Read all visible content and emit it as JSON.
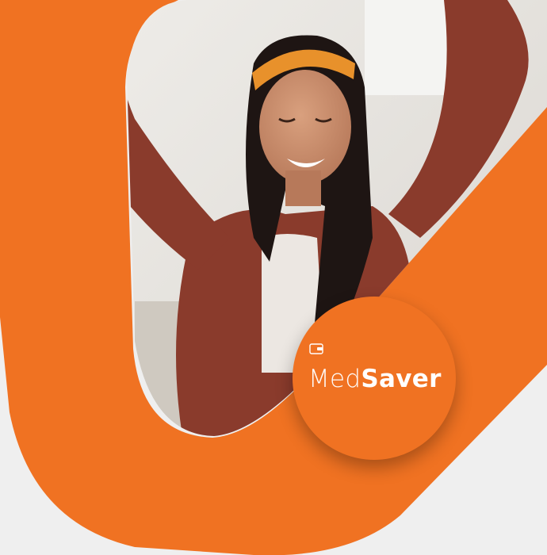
{
  "brand": {
    "name_light": "Med",
    "name_bold": "Saver",
    "icon": "wallet-icon"
  },
  "colors": {
    "accent_orange": "#f07222",
    "background": "#efefef",
    "sweater": "#8a3b2c",
    "headband": "#e8912b",
    "hair": "#1e1513",
    "skin": "#c98a68",
    "room": "#e6e4df"
  },
  "photo": {
    "subject": "smiling-woman-with-raised-arms"
  }
}
